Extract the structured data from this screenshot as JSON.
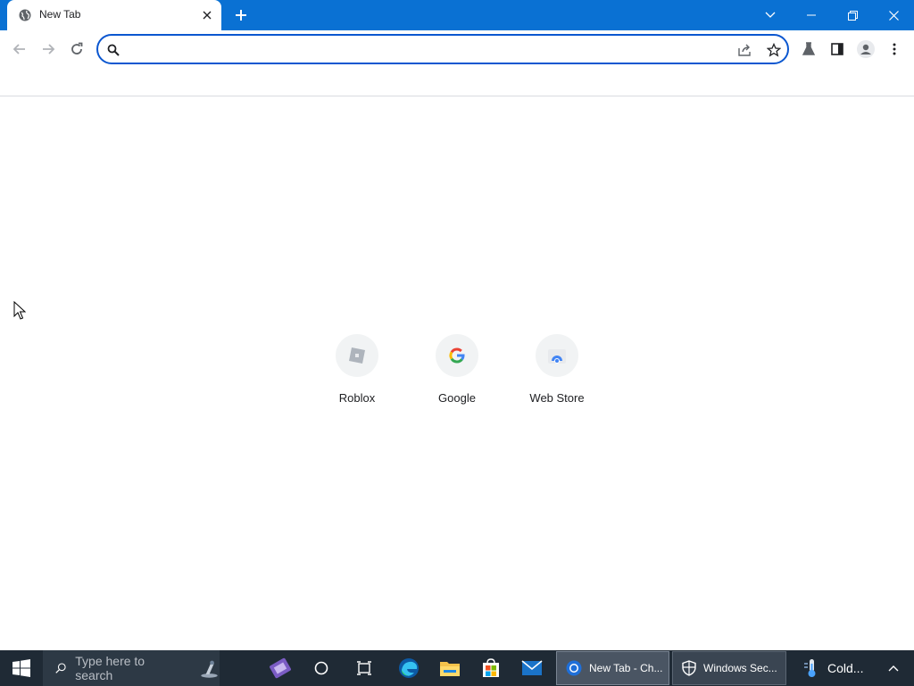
{
  "browser": {
    "tab": {
      "title": "New Tab"
    },
    "omnibox": {
      "value": "",
      "placeholder": ""
    }
  },
  "shortcuts": [
    {
      "label": "Roblox"
    },
    {
      "label": "Google"
    },
    {
      "label": "Web Store"
    }
  ],
  "taskbar": {
    "search_placeholder": "Type here to search",
    "windows": [
      {
        "label": "New Tab - Ch..."
      },
      {
        "label": "Windows Sec..."
      },
      {
        "label": "Cold..."
      }
    ]
  },
  "colors": {
    "titlebar": "#0a71d3",
    "accent": "#0b57d0",
    "taskbar": "#1f2a35"
  }
}
